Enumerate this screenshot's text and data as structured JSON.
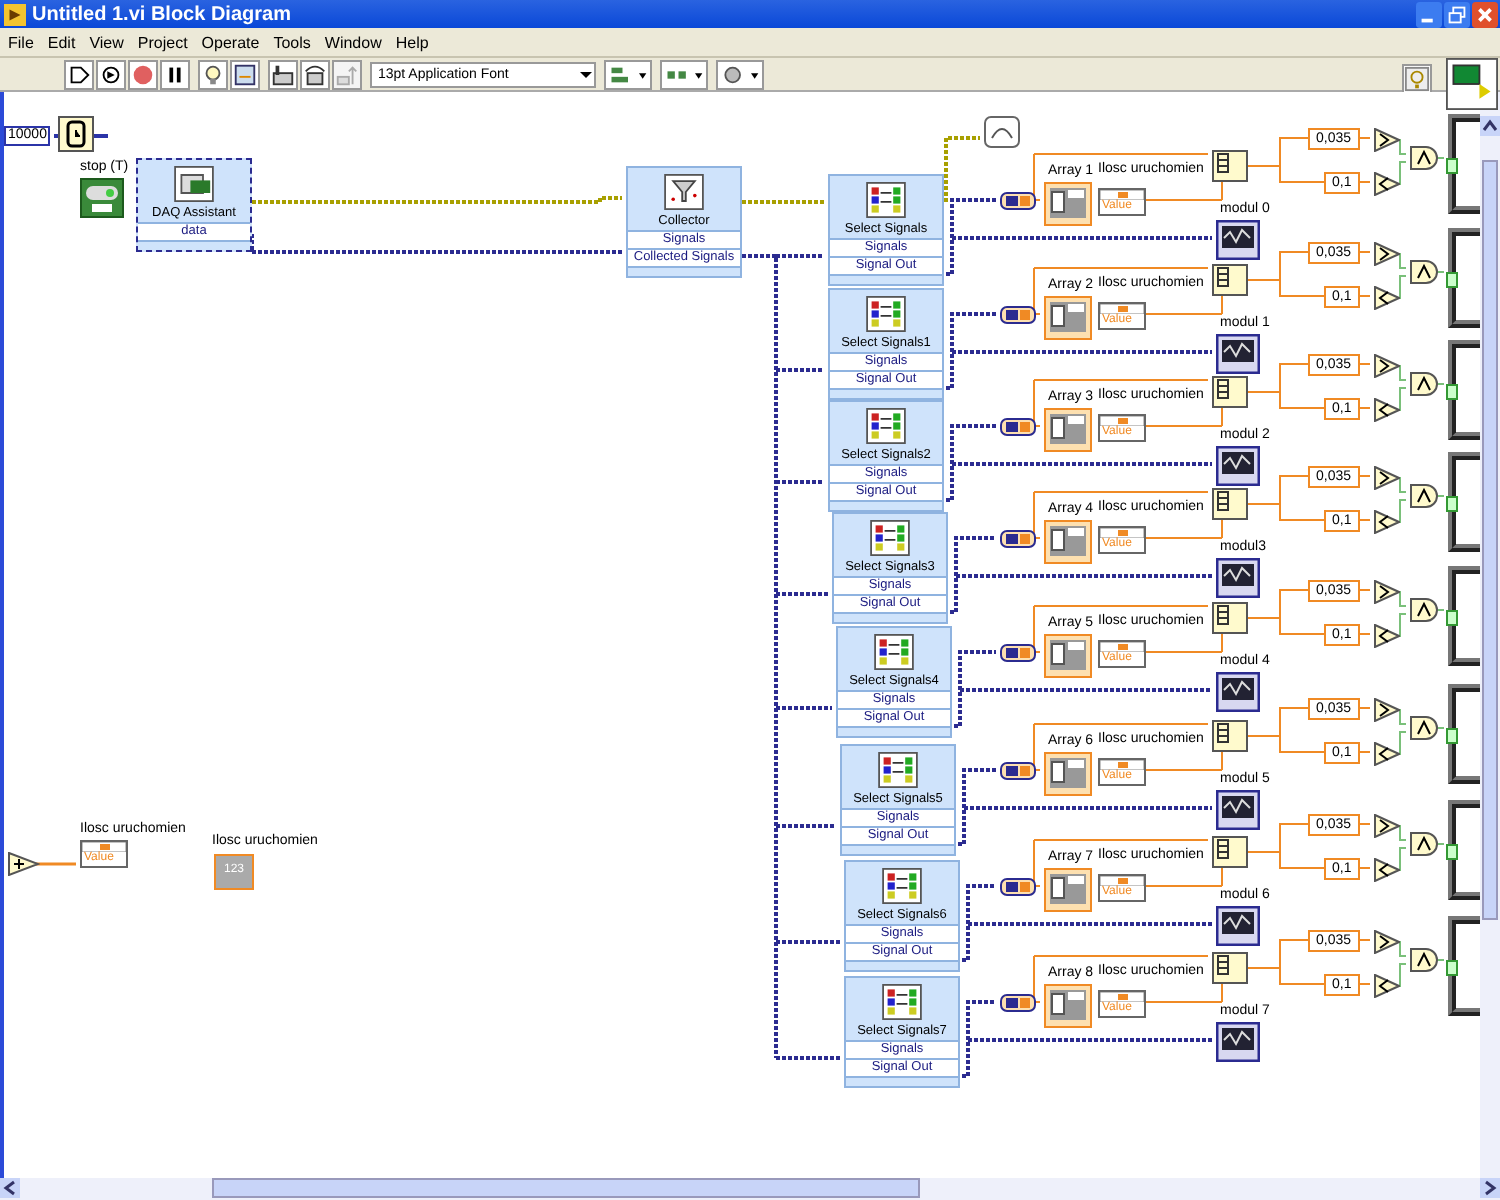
{
  "window": {
    "title": "Untitled 1.vi Block Diagram"
  },
  "menu": [
    "File",
    "Edit",
    "View",
    "Project",
    "Operate",
    "Tools",
    "Window",
    "Help"
  ],
  "toolbar": {
    "font": "13pt Application Font"
  },
  "diagram": {
    "wait_constant": "10000",
    "stop_label": "stop (T)",
    "daq": {
      "title": "DAQ Assistant",
      "output": "data"
    },
    "collector": {
      "title": "Collector",
      "terminals": [
        "Signals",
        "Collected Signals"
      ]
    },
    "rows": [
      {
        "select_title": "Select Signals",
        "terminals": [
          "Signals",
          "Signal Out"
        ],
        "array_label": "Array 1",
        "indicator_label": "Ilosc uruchomien",
        "indicator_property": "Value",
        "graph_label": "modul 0",
        "thresholds": [
          "0,035",
          "0,1"
        ]
      },
      {
        "select_title": "Select Signals1",
        "terminals": [
          "Signals",
          "Signal Out"
        ],
        "array_label": "Array 2",
        "indicator_label": "Ilosc uruchomien",
        "indicator_property": "Value",
        "graph_label": "modul 1",
        "thresholds": [
          "0,035",
          "0,1"
        ]
      },
      {
        "select_title": "Select Signals2",
        "terminals": [
          "Signals",
          "Signal Out"
        ],
        "array_label": "Array 3",
        "indicator_label": "Ilosc uruchomien",
        "indicator_property": "Value",
        "graph_label": "modul 2",
        "thresholds": [
          "0,035",
          "0,1"
        ]
      },
      {
        "select_title": "Select Signals3",
        "terminals": [
          "Signals",
          "Signal Out"
        ],
        "array_label": "Array 4",
        "indicator_label": "Ilosc uruchomien",
        "indicator_property": "Value",
        "graph_label": "modul3",
        "thresholds": [
          "0,035",
          "0,1"
        ]
      },
      {
        "select_title": "Select Signals4",
        "terminals": [
          "Signals",
          "Signal Out"
        ],
        "array_label": "Array 5",
        "indicator_label": "Ilosc uruchomien",
        "indicator_property": "Value",
        "graph_label": "modul 4",
        "thresholds": [
          "0,035",
          "0,1"
        ]
      },
      {
        "select_title": "Select Signals5",
        "terminals": [
          "Signals",
          "Signal Out"
        ],
        "array_label": "Array 6",
        "indicator_label": "Ilosc uruchomien",
        "indicator_property": "Value",
        "graph_label": "modul 5",
        "thresholds": [
          "0,035",
          "0,1"
        ]
      },
      {
        "select_title": "Select Signals6",
        "terminals": [
          "Signals",
          "Signal Out"
        ],
        "array_label": "Array 7",
        "indicator_label": "Ilosc uruchomien",
        "indicator_property": "Value",
        "graph_label": "modul 6",
        "thresholds": [
          "0,035",
          "0,1"
        ]
      },
      {
        "select_title": "Select Signals7",
        "terminals": [
          "Signals",
          "Signal Out"
        ],
        "array_label": "Array 8",
        "indicator_label": "Ilosc uruchomien",
        "indicator_property": "Value",
        "graph_label": "modul 7",
        "thresholds": [
          "0,035",
          "0,1"
        ]
      }
    ],
    "counter": {
      "property_label": "Ilosc uruchomien",
      "property": "Value",
      "indicator_label": "Ilosc uruchomien",
      "indicator_value": "123"
    }
  }
}
